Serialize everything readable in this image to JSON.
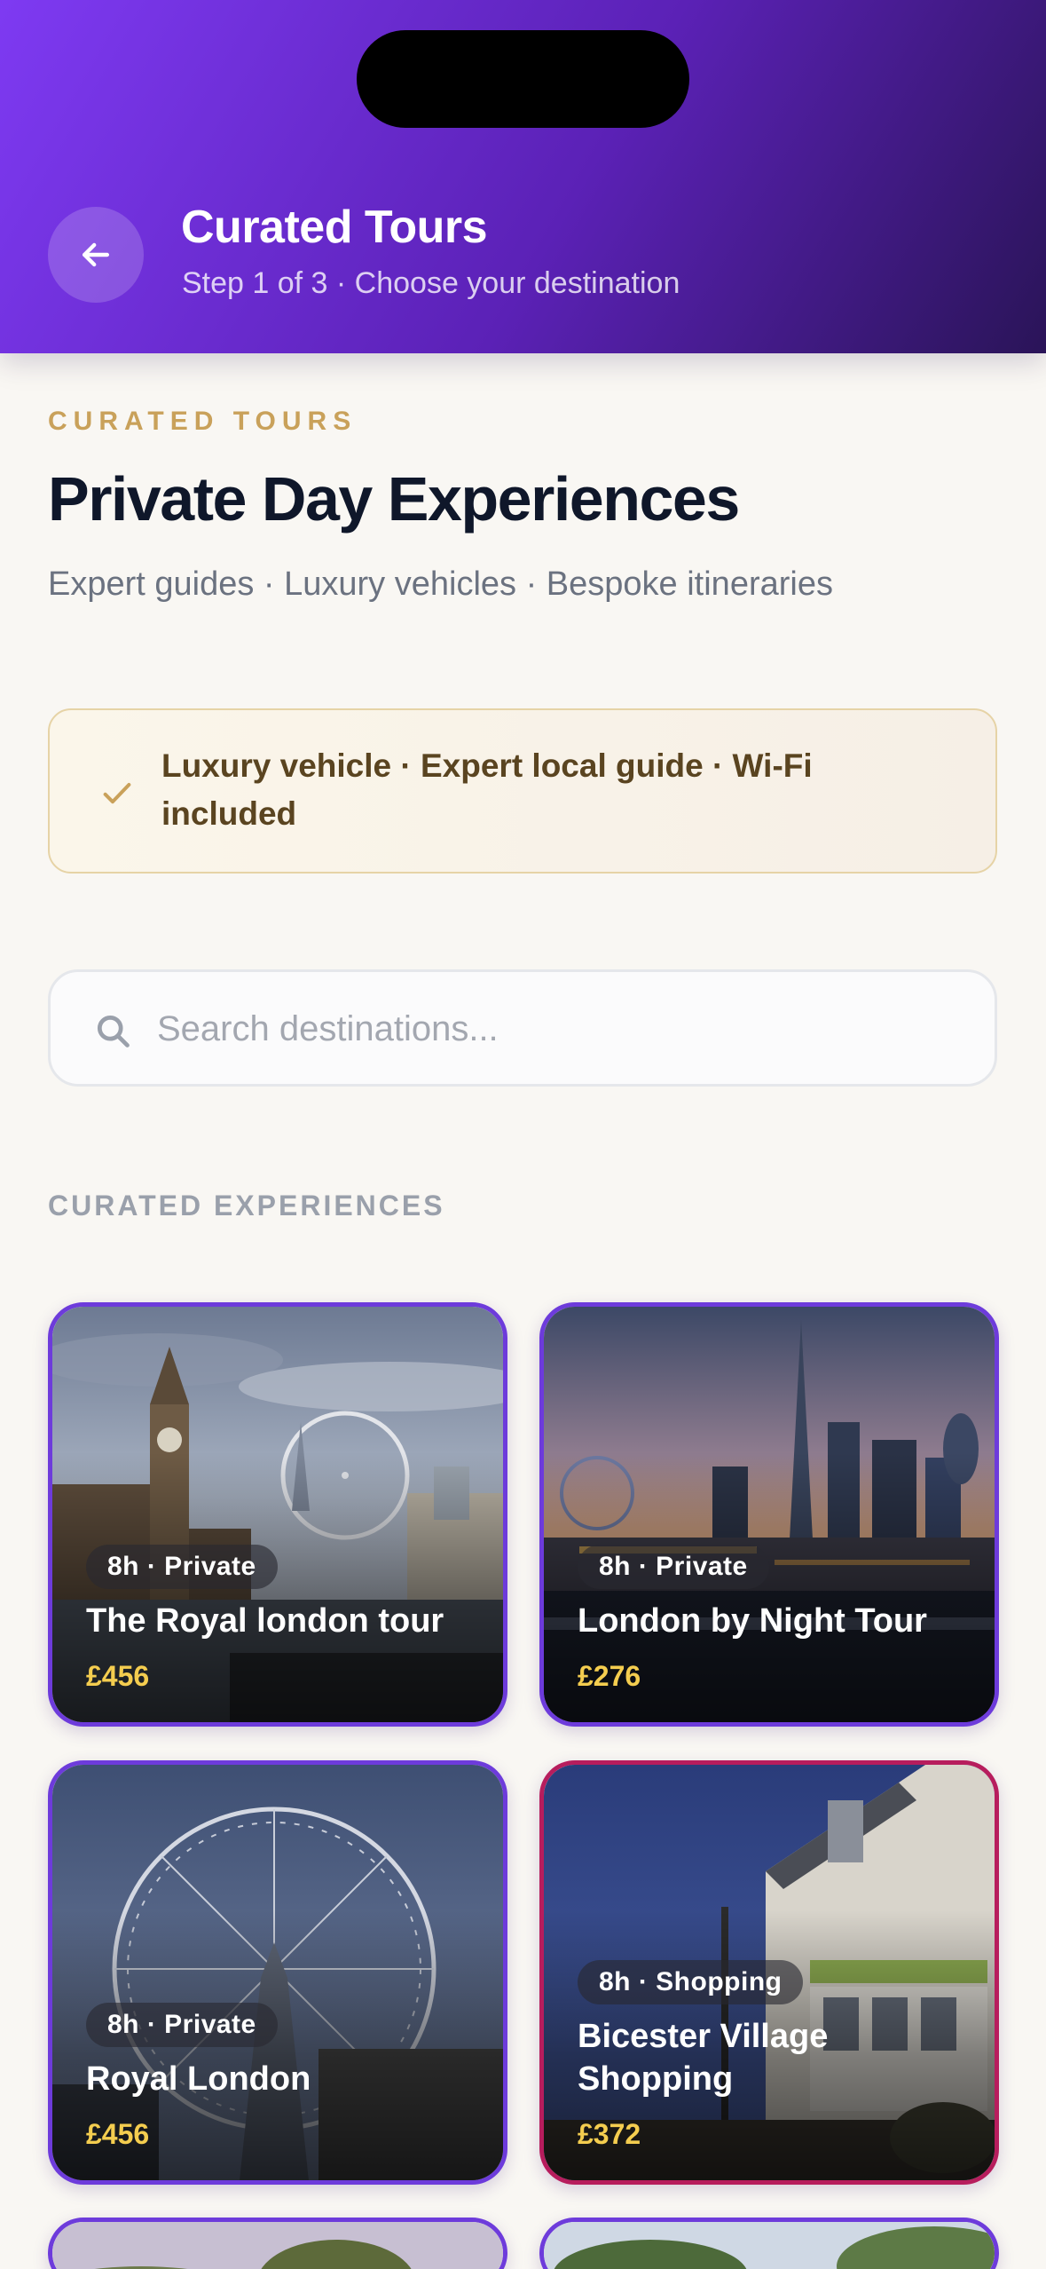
{
  "header": {
    "title": "Curated Tours",
    "subtitle": "Step 1 of 3 · Choose your destination"
  },
  "intro": {
    "eyebrow": "CURATED TOURS",
    "title": "Private Day Experiences",
    "subtitle": "Expert guides · Luxury vehicles · Bespoke itineraries"
  },
  "notice": {
    "text": "Luxury vehicle · Expert local guide · Wi-Fi included"
  },
  "search": {
    "placeholder": "Search destinations..."
  },
  "section": {
    "label": "CURATED EXPERIENCES"
  },
  "cards": [
    {
      "meta": "8h · Private",
      "title": "The Royal london tour",
      "price": "£456"
    },
    {
      "meta": "8h · Private",
      "title": "London by Night Tour",
      "price": "£276"
    },
    {
      "meta": "8h · Private",
      "title": "Royal London",
      "price": "£456"
    },
    {
      "meta": "8h · Shopping",
      "title": "Bicester Village Shopping",
      "price": "£372"
    }
  ],
  "colors": {
    "header_gradient_start": "#7e3af2",
    "header_gradient_end": "#2a1458",
    "accent_gold": "#c9a15a",
    "price_yellow": "#f4cd4f",
    "card_border_purple": "#6d3bdb",
    "card_border_pink": "#b71d5d"
  }
}
